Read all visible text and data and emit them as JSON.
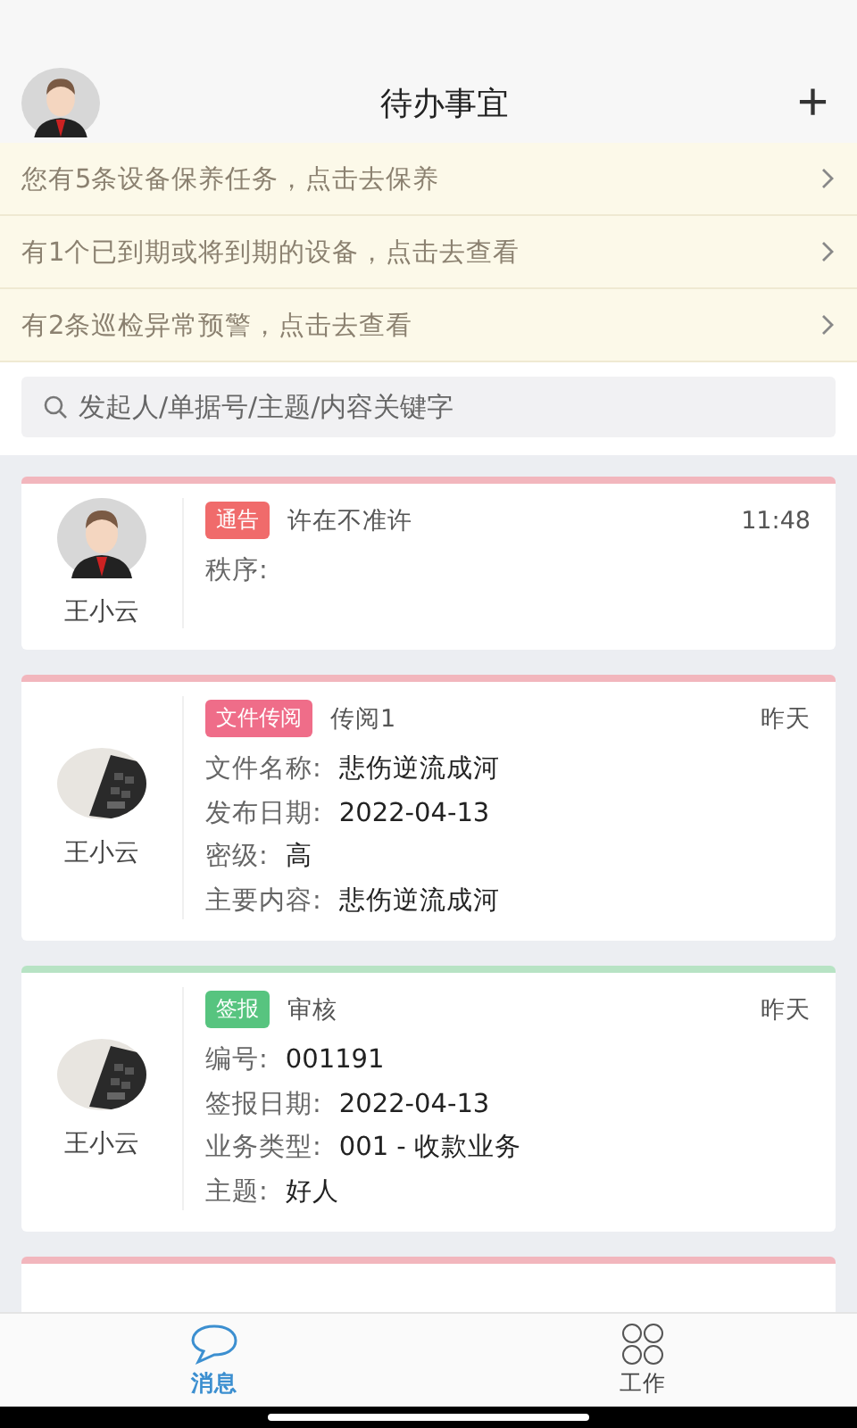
{
  "header": {
    "title": "待办事宜",
    "add": "+"
  },
  "notices": [
    {
      "text": "您有5条设备保养任务，点击去保养"
    },
    {
      "text": "有1个已到期或将到期的设备，点击去查看"
    },
    {
      "text": "有2条巡检异常预警，点击去查看"
    }
  ],
  "search": {
    "placeholder": "发起人/单据号/主题/内容关键字"
  },
  "cards": [
    {
      "color": "#f2b6bd",
      "tag": {
        "text": "通告",
        "color": "#f06b6b"
      },
      "title": "许在不准许",
      "time": "11:48",
      "sender": "王小云",
      "kind": "person",
      "fields": [
        {
          "label": "秩序:"
        }
      ]
    },
    {
      "color": "#f2b6bd",
      "tag": {
        "text": "文件传阅",
        "color": "#ef6d89"
      },
      "title": "传阅1",
      "time": "昨天",
      "sender": "王小云",
      "kind": "picture",
      "fields": [
        {
          "label": "文件名称:",
          "value": "悲伤逆流成河"
        },
        {
          "label": "发布日期:",
          "value": "2022-04-13"
        },
        {
          "label": "密级:",
          "value": "高"
        },
        {
          "label": "主要内容:",
          "value": "悲伤逆流成河"
        }
      ]
    },
    {
      "color": "#b7e3c4",
      "tag": {
        "text": "签报",
        "color": "#57c47f"
      },
      "title": "审核",
      "time": "昨天",
      "sender": "王小云",
      "kind": "picture",
      "fields": [
        {
          "label": "编号:",
          "value": "001191"
        },
        {
          "label": "签报日期:",
          "value": "2022-04-13"
        },
        {
          "label": "业务类型:",
          "value": "001 - 收款业务"
        },
        {
          "label": "主题:",
          "value": "好人"
        }
      ]
    },
    {
      "color": "#f2b6bd"
    }
  ],
  "tabs": [
    {
      "label": "消息",
      "kind": "chat",
      "selected": true
    },
    {
      "label": "工作",
      "kind": "work",
      "selected": false
    }
  ]
}
